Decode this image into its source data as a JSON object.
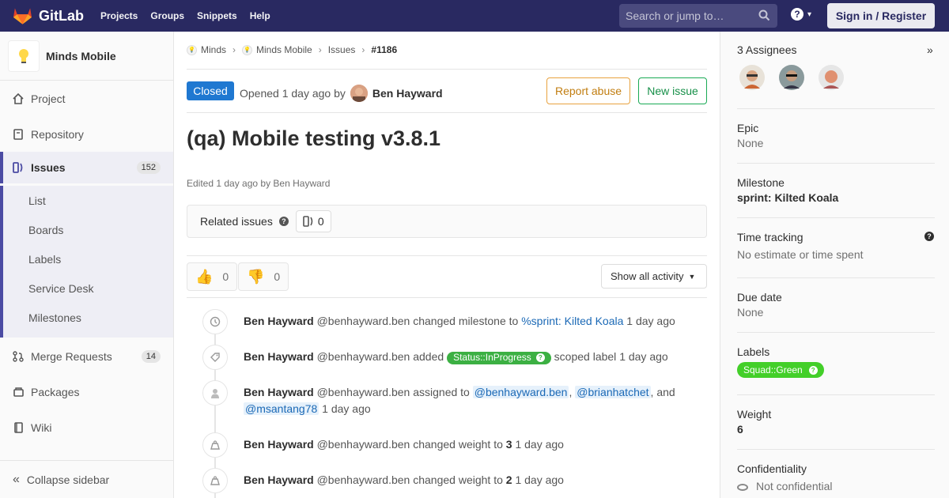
{
  "topbar": {
    "brand": "GitLab",
    "nav": [
      "Projects",
      "Groups",
      "Snippets",
      "Help"
    ],
    "search_placeholder": "Search or jump to…",
    "help_icon": "?",
    "signin_label": "Sign in / Register"
  },
  "sidebar": {
    "project_name": "Minds Mobile",
    "items": [
      {
        "label": "Project",
        "icon": "home-icon"
      },
      {
        "label": "Repository",
        "icon": "doc-icon"
      },
      {
        "label": "Issues",
        "icon": "issues-icon",
        "count": "152"
      },
      {
        "label": "Merge Requests",
        "icon": "merge-icon",
        "count": "14"
      },
      {
        "label": "Packages",
        "icon": "package-icon"
      },
      {
        "label": "Wiki",
        "icon": "book-icon"
      }
    ],
    "issues_sub": [
      "List",
      "Boards",
      "Labels",
      "Service Desk",
      "Milestones"
    ],
    "collapse_label": "Collapse sidebar"
  },
  "breadcrumb": [
    "Minds",
    "Minds Mobile",
    "Issues",
    "#1186"
  ],
  "issue": {
    "status": "Closed",
    "opened_prefix": "Opened 1 day ago by",
    "author": "Ben Hayward",
    "report_label": "Report abuse",
    "new_label": "New issue",
    "title": "(qa) Mobile testing v3.8.1",
    "edited": "Edited 1 day ago by Ben Hayward",
    "related_label": "Related issues",
    "related_count": "0",
    "thumbs_up": "0",
    "thumbs_down": "0",
    "activity_filter": "Show all activity"
  },
  "notes": [
    {
      "icon": "clock-icon",
      "who": "Ben Hayward",
      "handle": "@benhayward.ben",
      "text": "changed milestone to",
      "link": "%sprint: Kilted Koala",
      "time": "1 day ago"
    },
    {
      "icon": "tag-icon",
      "who": "Ben Hayward",
      "handle": "@benhayward.ben",
      "text": "added",
      "label": "Status::InProgress",
      "after": "scoped label",
      "time": "1 day ago"
    },
    {
      "icon": "user-icon",
      "who": "Ben Hayward",
      "handle": "@benhayward.ben",
      "text": "assigned to",
      "m1": "@benhayward.ben",
      "m2": "@brianhatchet",
      "and": ", and",
      "m3": "@msantang78",
      "time": "1 day ago"
    },
    {
      "icon": "weight-icon",
      "who": "Ben Hayward",
      "handle": "@benhayward.ben",
      "text": "changed weight to",
      "value": "3",
      "time": "1 day ago"
    },
    {
      "icon": "weight-icon",
      "who": "Ben Hayward",
      "handle": "@benhayward.ben",
      "text": "changed weight to",
      "value": "2",
      "time": "1 day ago"
    }
  ],
  "right": {
    "assignees_title": "3 Assignees",
    "epic_title": "Epic",
    "epic_value": "None",
    "milestone_title": "Milestone",
    "milestone_value": "sprint: Kilted Koala",
    "time_title": "Time tracking",
    "time_value": "No estimate or time spent",
    "due_title": "Due date",
    "due_value": "None",
    "labels_title": "Labels",
    "label": "Squad::Green",
    "weight_title": "Weight",
    "weight_value": "6",
    "conf_title": "Confidentiality",
    "conf_value": "Not confidential"
  },
  "colors": {
    "nav": "#292961",
    "accent": "#4b4ba3",
    "closed": "#1f78d1",
    "scoped_label": "#3cb043",
    "squad_label": "#43cf29"
  }
}
